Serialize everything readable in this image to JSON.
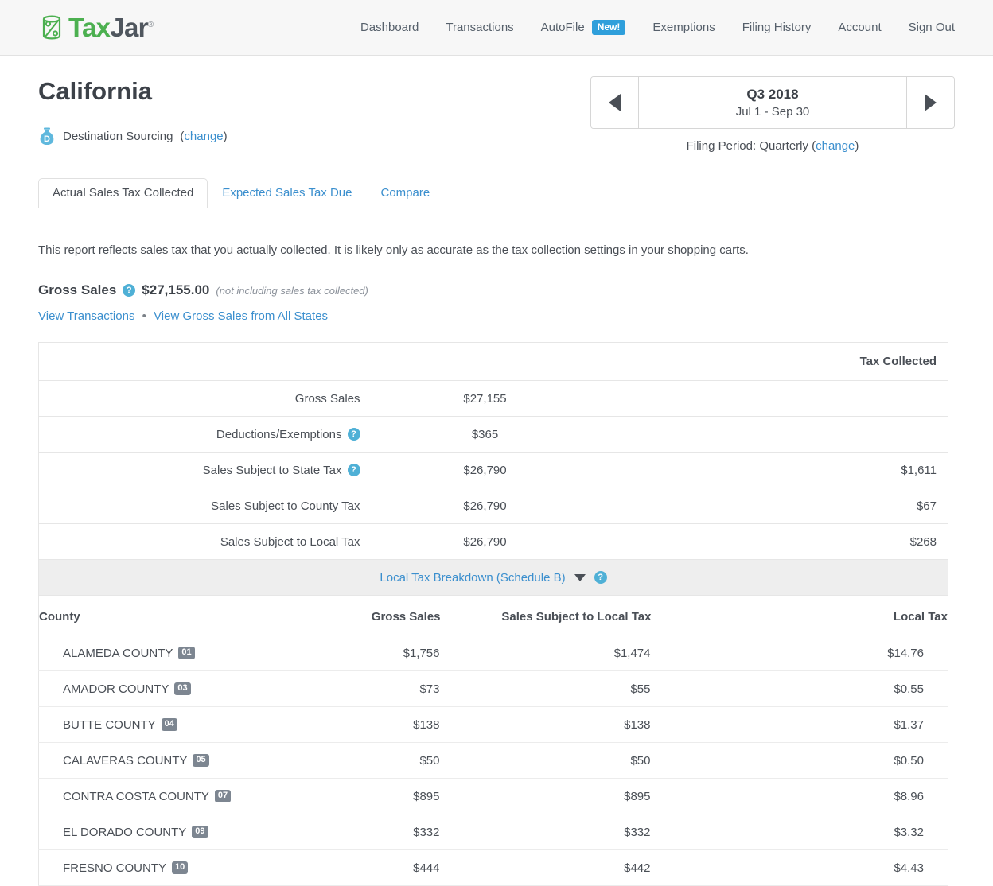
{
  "brand": {
    "name_part1": "Tax",
    "name_part2": "Jar",
    "registered": "®",
    "logo_symbol": "%"
  },
  "nav": {
    "items": [
      {
        "label": "Dashboard"
      },
      {
        "label": "Transactions"
      },
      {
        "label": "AutoFile",
        "badge": "New!"
      },
      {
        "label": "Exemptions"
      },
      {
        "label": "Filing History"
      },
      {
        "label": "Account"
      },
      {
        "label": "Sign Out"
      }
    ]
  },
  "header": {
    "state_title": "California",
    "sourcing_label": "Destination Sourcing",
    "sourcing_change": "(change)",
    "sourcing_change_link": "change",
    "sourcing_icon_letter": "D"
  },
  "period": {
    "prev_label": "◀",
    "next_label": "▶",
    "title": "Q3 2018",
    "range": "Jul 1 - Sep 30",
    "filing_period_text": "Filing Period: Quarterly (",
    "filing_period_link": "change",
    "filing_period_close": ")"
  },
  "tabs": [
    {
      "label": "Actual Sales Tax Collected",
      "active": true
    },
    {
      "label": "Expected Sales Tax Due",
      "active": false
    },
    {
      "label": "Compare",
      "active": false
    }
  ],
  "report": {
    "description": "This report reflects sales tax that you actually collected. It is likely only as accurate as the tax collection settings in your shopping carts.",
    "gross_sales_label": "Gross Sales",
    "gross_sales_value": "$27,155.00",
    "gross_sales_note": "(not including sales tax collected)",
    "link_view_transactions": "View Transactions",
    "link_separator": "•",
    "link_view_all_states": "View Gross Sales from All States",
    "help_glyph": "?"
  },
  "summary_table": {
    "header_blank": "",
    "header_amount_blank": "",
    "header_tax_collected": "Tax Collected",
    "rows": [
      {
        "label": "Gross Sales",
        "has_help": false,
        "amount": "$27,155",
        "tax": ""
      },
      {
        "label": "Deductions/Exemptions",
        "has_help": true,
        "amount": "$365",
        "tax": ""
      },
      {
        "label": "Sales Subject to State Tax",
        "has_help": true,
        "amount": "$26,790",
        "tax": "$1,611"
      },
      {
        "label": "Sales Subject to County Tax",
        "has_help": false,
        "amount": "$26,790",
        "tax": "$67"
      },
      {
        "label": "Sales Subject to Local Tax",
        "has_help": false,
        "amount": "$26,790",
        "tax": "$268"
      }
    ]
  },
  "breakdown": {
    "title": "Local Tax Breakdown (Schedule B)",
    "columns": {
      "county": "County",
      "gross_sales": "Gross Sales",
      "subject_local": "Sales Subject to Local Tax",
      "local_tax": "Local Tax"
    },
    "rows": [
      {
        "county": "ALAMEDA COUNTY",
        "code": "01",
        "gross": "$1,756",
        "subject": "$1,474",
        "local_tax": "$14.76"
      },
      {
        "county": "AMADOR COUNTY",
        "code": "03",
        "gross": "$73",
        "subject": "$55",
        "local_tax": "$0.55"
      },
      {
        "county": "BUTTE COUNTY",
        "code": "04",
        "gross": "$138",
        "subject": "$138",
        "local_tax": "$1.37"
      },
      {
        "county": "CALAVERAS COUNTY",
        "code": "05",
        "gross": "$50",
        "subject": "$50",
        "local_tax": "$0.50"
      },
      {
        "county": "CONTRA COSTA COUNTY",
        "code": "07",
        "gross": "$895",
        "subject": "$895",
        "local_tax": "$8.96"
      },
      {
        "county": "EL DORADO COUNTY",
        "code": "09",
        "gross": "$332",
        "subject": "$332",
        "local_tax": "$3.32"
      },
      {
        "county": "FRESNO COUNTY",
        "code": "10",
        "gross": "$444",
        "subject": "$442",
        "local_tax": "$4.43"
      }
    ]
  },
  "colors": {
    "brand_green": "#4cb050",
    "brand_dark": "#4f565e",
    "link_blue": "#3b8fce",
    "badge_blue": "#2f9fdb",
    "help_blue": "#4fb0d6",
    "code_badge_gray": "#7d8691",
    "header_bg": "#f7f7f7",
    "breakdown_bar_bg": "#eeeeee"
  }
}
